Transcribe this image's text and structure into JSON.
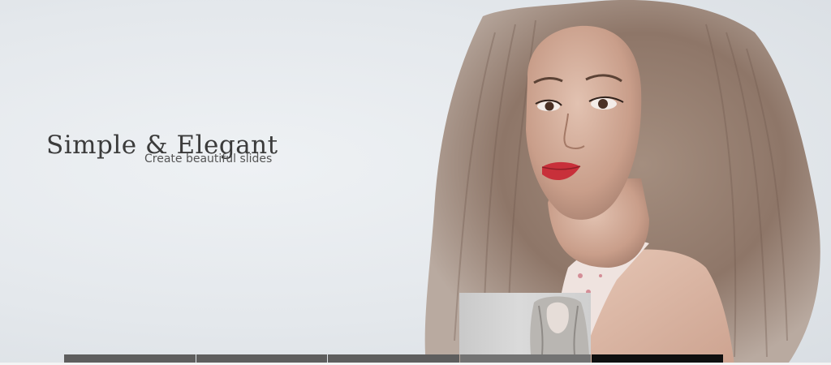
{
  "slide": {
    "title": "Simple & Elegant",
    "subtitle": "Create beautiful slides"
  },
  "colors": {
    "background": "#e6e9ec",
    "title": "#3b3b3b",
    "subtitle": "#555555",
    "thumb_default": "#5e5e5e",
    "thumb_hover": "#737373",
    "thumb_active": "#0f0f0f",
    "lips": "#c8303a"
  },
  "thumbnails": {
    "count": 5,
    "active_index": 4,
    "hover_preview_index": 3
  }
}
